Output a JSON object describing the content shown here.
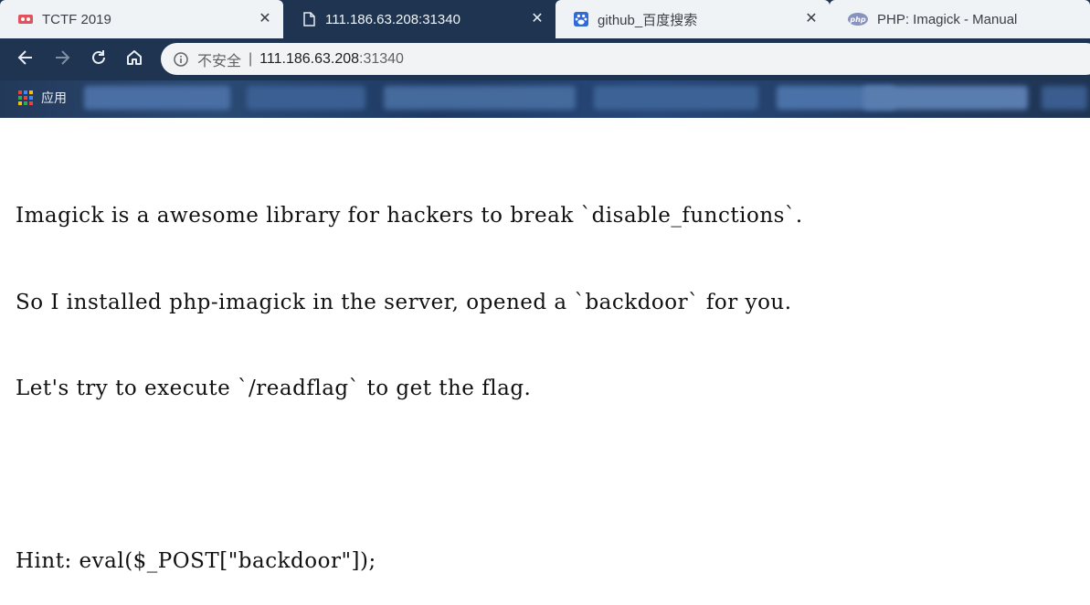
{
  "tabs": [
    {
      "title": "TCTF 2019",
      "icon": "tctf-favicon-icon",
      "active": false
    },
    {
      "title": "111.186.63.208:31340",
      "icon": "page-document-icon",
      "active": true
    },
    {
      "title": "github_百度搜索",
      "icon": "baidu-paw-icon",
      "active": false
    },
    {
      "title": "PHP: Imagick - Manual",
      "icon": "php-logo-icon",
      "active": false
    }
  ],
  "toolbar": {
    "back_icon": "back-arrow-icon",
    "forward_icon": "forward-arrow-icon",
    "reload_icon": "reload-icon",
    "home_icon": "home-icon"
  },
  "omnibox": {
    "security_label": "不安全",
    "separator": "|",
    "host": "111.186.63.208",
    "port": ":31340"
  },
  "bookmarks": {
    "apps_label": "应用"
  },
  "page": {
    "lines": [
      "Imagick is a awesome library for hackers to break `disable_functions`.",
      "So I installed php-imagick in the server, opened a `backdoor` for you.",
      "Let's try to execute `/readflag` to get the flag."
    ],
    "hint": "Hint: eval($_POST[\"backdoor\"]);"
  }
}
